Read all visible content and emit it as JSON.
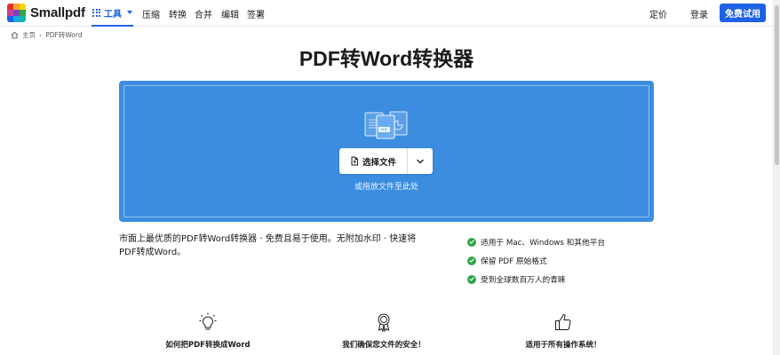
{
  "header": {
    "brand": "Smallpdf",
    "tools_label": "工具",
    "menu": [
      "压缩",
      "转换",
      "合并",
      "编辑",
      "签署"
    ],
    "pricing_label": "定价",
    "login_label": "登录",
    "trial_label": "免费试用",
    "accent_color": "#1d61e6"
  },
  "breadcrumb": {
    "home": "主页",
    "current": "PDF转Word"
  },
  "page": {
    "title": "PDF转Word转换器"
  },
  "dropzone": {
    "choose_label": "选择文件",
    "hint": "或拖放文件至此处",
    "file_badge": "PDF",
    "bg_color": "#3c8de0"
  },
  "description": "市面上最优质的PDF转Word转换器 · 免费且易于使用。无附加水印 · 快速将PDF转成Word。",
  "features": [
    "适用于 Mac、Windows 和其他平台",
    "保留 PDF 原始格式",
    "受到全球数百万人的青睐"
  ],
  "cards": [
    {
      "title": "如何把PDF转换成Word",
      "icon": "lightbulb-icon"
    },
    {
      "title": "我们确保您文件的安全！",
      "icon": "award-icon"
    },
    {
      "title": "适用于所有操作系统！",
      "icon": "thumbs-up-icon"
    }
  ]
}
